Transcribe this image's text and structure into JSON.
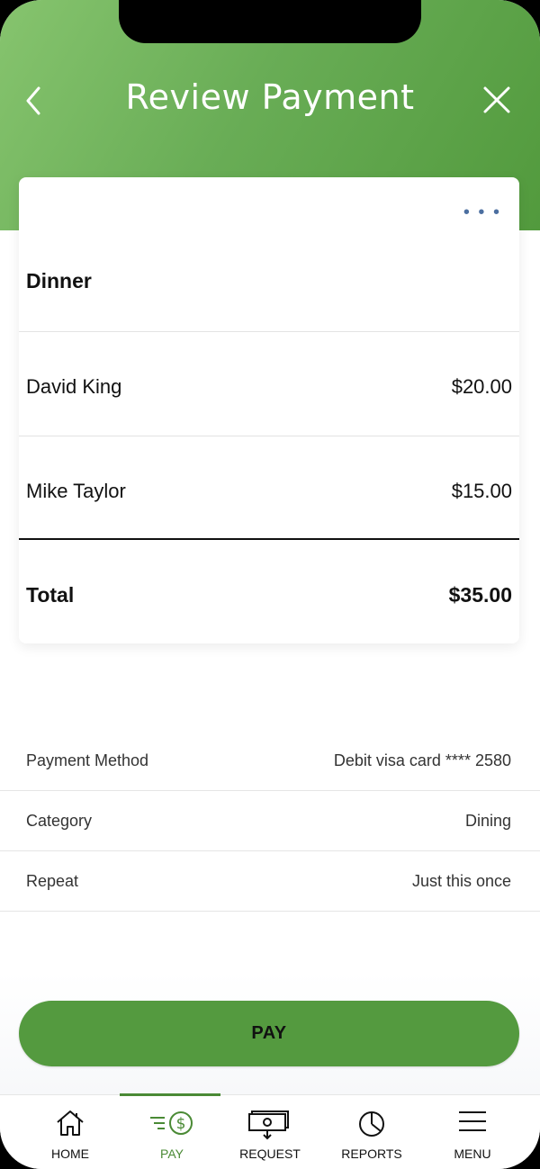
{
  "header": {
    "title": "Review Payment"
  },
  "card": {
    "title": "Dinner",
    "items": [
      {
        "name": "David King",
        "amount": "$20.00"
      },
      {
        "name": "Mike Taylor",
        "amount": "$15.00"
      }
    ],
    "total_label": "Total",
    "total_amount": "$35.00"
  },
  "details": [
    {
      "label": "Payment Method",
      "value": "Debit visa card **** 2580"
    },
    {
      "label": "Category",
      "value": "Dining"
    },
    {
      "label": "Repeat",
      "value": "Just this once"
    }
  ],
  "pay_button": {
    "label": "PAY"
  },
  "tabs": [
    {
      "label": "HOME",
      "icon": "home-icon"
    },
    {
      "label": "PAY",
      "icon": "pay-icon"
    },
    {
      "label": "REQUEST",
      "icon": "request-icon"
    },
    {
      "label": "REPORTS",
      "icon": "reports-icon"
    },
    {
      "label": "MENU",
      "icon": "menu-icon"
    }
  ],
  "colors": {
    "brand_green": "#549a3f",
    "header_light": "#86c46e",
    "active_tab": "#4a8a35"
  }
}
